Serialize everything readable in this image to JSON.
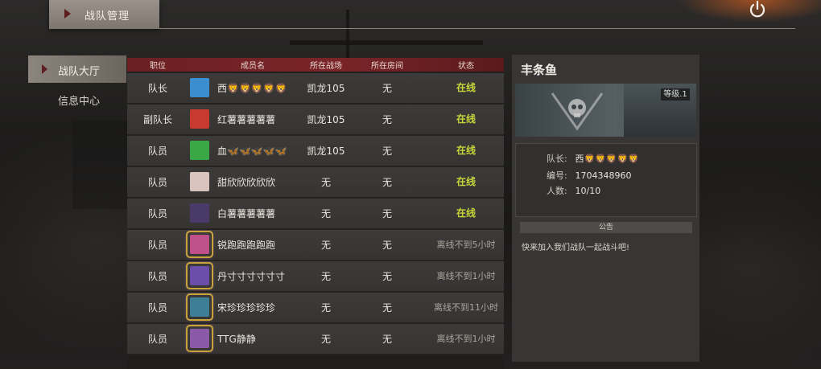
{
  "header": {
    "title": "战队管理"
  },
  "nav": [
    {
      "label": "战队大厅",
      "active": true
    },
    {
      "label": "信息中心",
      "active": false
    }
  ],
  "table": {
    "columns": [
      "职位",
      "成员名",
      "所在战场",
      "所在房间",
      "状态"
    ],
    "rows": [
      {
        "role": "队长",
        "name": "西🦁🦁🦁🦁🦁",
        "team": "凯龙105",
        "room": "无",
        "status": "在线",
        "online": true,
        "avatar_color": "#3b8fd0"
      },
      {
        "role": "副队长",
        "name": "红薯薯薯薯薯",
        "team": "凯龙105",
        "room": "无",
        "status": "在线",
        "online": true,
        "avatar_color": "#c83a2e"
      },
      {
        "role": "队员",
        "name": "血🦋🦋🦋🦋🦋",
        "team": "凯龙105",
        "room": "无",
        "status": "在线",
        "online": true,
        "avatar_color": "#3aa845"
      },
      {
        "role": "队员",
        "name": "甜欣欣欣欣欣",
        "team": "无",
        "room": "无",
        "status": "在线",
        "online": true,
        "avatar_color": "#d8c4bc"
      },
      {
        "role": "队员",
        "name": "白薯薯薯薯薯",
        "team": "无",
        "room": "无",
        "status": "在线",
        "online": true,
        "avatar_color": "#4a3a6a"
      },
      {
        "role": "队员",
        "name": "锐跑跑跑跑跑",
        "team": "无",
        "room": "无",
        "status": "离线不到5小时",
        "online": false,
        "avatar_color": "#c0508a"
      },
      {
        "role": "队员",
        "name": "丹寸寸寸寸寸寸",
        "team": "无",
        "room": "无",
        "status": "离线不到1小时",
        "online": false,
        "avatar_color": "#6a4ea8"
      },
      {
        "role": "队员",
        "name": "宋珍珍珍珍珍",
        "team": "无",
        "room": "无",
        "status": "离线不到11小时",
        "online": false,
        "avatar_color": "#3f7f96"
      },
      {
        "role": "队员",
        "name": "TTG静静",
        "team": "无",
        "room": "无",
        "status": "离线不到1小时",
        "online": false,
        "avatar_color": "#8a5aa8"
      }
    ]
  },
  "panel": {
    "team_name": "丰条鱼",
    "level": "等级.1",
    "captain_label": "队长:",
    "captain": "西🦁🦁🦁🦁🦁",
    "id_label": "编号:",
    "id": "1704348960",
    "count_label": "人数:",
    "count": "10/10",
    "notice_title": "公告",
    "notice": "快来加入我们战队一起战斗吧!"
  },
  "colors": {
    "accent": "#7a2528",
    "online": "#c8d63a"
  }
}
